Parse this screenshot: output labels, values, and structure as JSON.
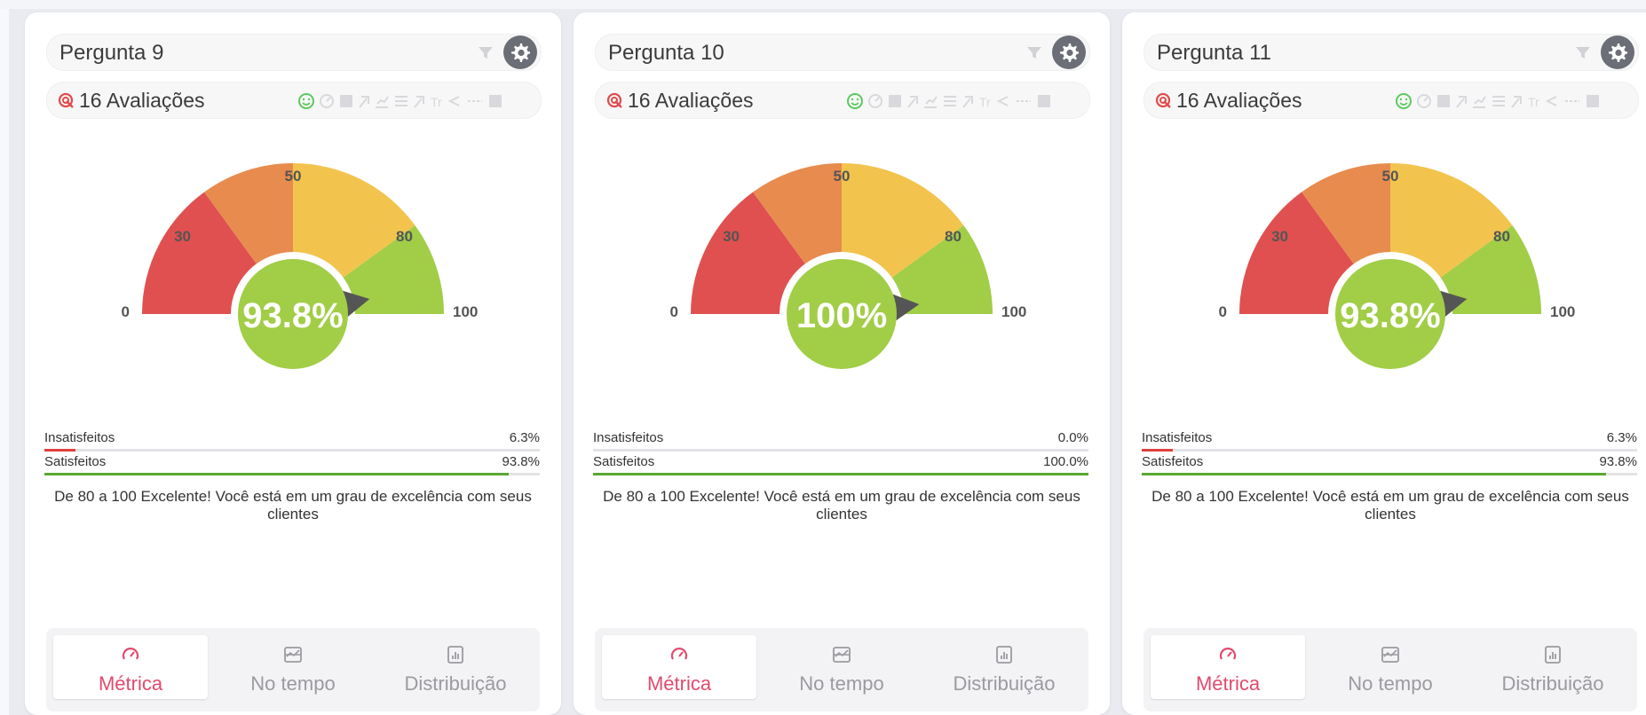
{
  "cards": [
    {
      "title": "Pergunta 9",
      "responses": "16 Avaliações",
      "gauge_value": 93.8,
      "gauge_label": "93.8%",
      "ticks": [
        "0",
        "30",
        "50",
        "80",
        "100"
      ],
      "insatisfeitos_label": "Insatisfeitos",
      "insatisfeitos_value": "6.3%",
      "insatisfeitos_pct": 6.3,
      "satisfeitos_label": "Satisfeitos",
      "satisfeitos_value": "93.8%",
      "satisfeitos_pct": 93.8,
      "description": "De 80 a 100 Excelente! Você está em um grau de excelência com seus clientes",
      "tabs": [
        "Métrica",
        "No tempo",
        "Distribuição"
      ],
      "active_tab": 0
    },
    {
      "title": "Pergunta 10",
      "responses": "16 Avaliações",
      "gauge_value": 100,
      "gauge_label": "100%",
      "ticks": [
        "0",
        "30",
        "50",
        "80",
        "100"
      ],
      "insatisfeitos_label": "Insatisfeitos",
      "insatisfeitos_value": "0.0%",
      "insatisfeitos_pct": 0,
      "satisfeitos_label": "Satisfeitos",
      "satisfeitos_value": "100.0%",
      "satisfeitos_pct": 100,
      "description": "De 80 a 100 Excelente! Você está em um grau de excelência com seus clientes",
      "tabs": [
        "Métrica",
        "No tempo",
        "Distribuição"
      ],
      "active_tab": 0
    },
    {
      "title": "Pergunta 11",
      "responses": "16 Avaliações",
      "gauge_value": 93.8,
      "gauge_label": "93.8%",
      "ticks": [
        "0",
        "30",
        "50",
        "80",
        "100"
      ],
      "insatisfeitos_label": "Insatisfeitos",
      "insatisfeitos_value": "6.3%",
      "insatisfeitos_pct": 6.3,
      "satisfeitos_label": "Satisfeitos",
      "satisfeitos_value": "93.8%",
      "satisfeitos_pct": 93.8,
      "description": "De 80 a 100 Excelente! Você está em um grau de excelência com seus clientes",
      "tabs": [
        "Métrica",
        "No tempo",
        "Distribuição"
      ],
      "active_tab": 0
    }
  ],
  "icons": {
    "filter": "filter-icon",
    "settings": "gear-icon",
    "responses": "target-icon",
    "toolbar": [
      "smiley-icon",
      "gauge-icon",
      "bar-icon",
      "line-icon",
      "scatter-icon",
      "list-icon",
      "trend-icon",
      "text-size-icon",
      "share-icon",
      "more-icon",
      "image-icon"
    ],
    "tabs": [
      "speedometer-icon",
      "timeline-icon",
      "distribution-icon"
    ]
  },
  "colors": {
    "red": "#e05050",
    "orange": "#e88b4f",
    "yellow": "#f2c44e",
    "green": "#a2cd47",
    "needle": "#555555",
    "insatisfeitos_bar": "#e04040",
    "satisfeitos_bar": "#5aa832",
    "active_tab": "#e14b6d"
  }
}
